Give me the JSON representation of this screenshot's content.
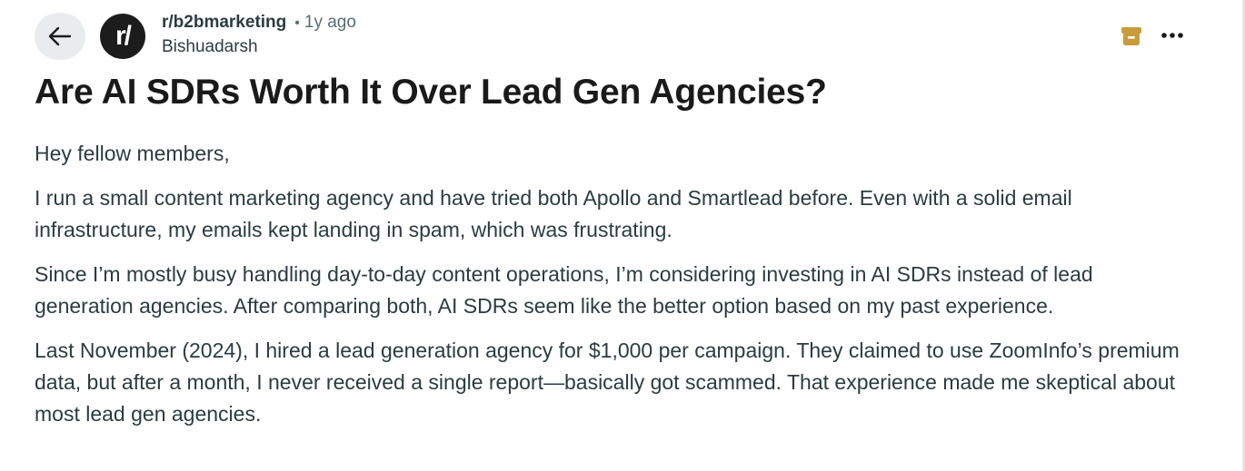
{
  "post": {
    "subreddit": "r/b2bmarketing",
    "separator": "•",
    "time_ago": "1y ago",
    "author": "Bishuadarsh",
    "avatar_text": "r/",
    "title": "Are AI SDRs Worth It Over Lead Gen Agencies?",
    "paragraphs": [
      "Hey fellow members,",
      "I run a small content marketing agency and have tried both Apollo and Smartlead before. Even with a solid email infrastructure, my emails kept landing in spam, which was frustrating.",
      "Since I’m mostly busy handling day-to-day content operations, I’m considering investing in AI SDRs instead of lead generation agencies. After comparing both, AI SDRs seem like the better option based on my past experience.",
      "Last November (2024), I hired a lead generation agency for $1,000 per campaign. They claimed to use ZoomInfo’s premium data, but after a month, I never received a single report—basically got scammed. That experience made me skeptical about most lead gen agencies."
    ]
  },
  "icons": {
    "back": "arrow-left-icon",
    "archive": "archive-icon",
    "more": "more-horizontal-icon"
  },
  "colors": {
    "archive_icon": "#c89b3c",
    "back_button_bg": "#e9ecef",
    "avatar_bg": "#1c1c1c",
    "text_primary": "#1a1a1b",
    "text_secondary": "#576f76"
  }
}
